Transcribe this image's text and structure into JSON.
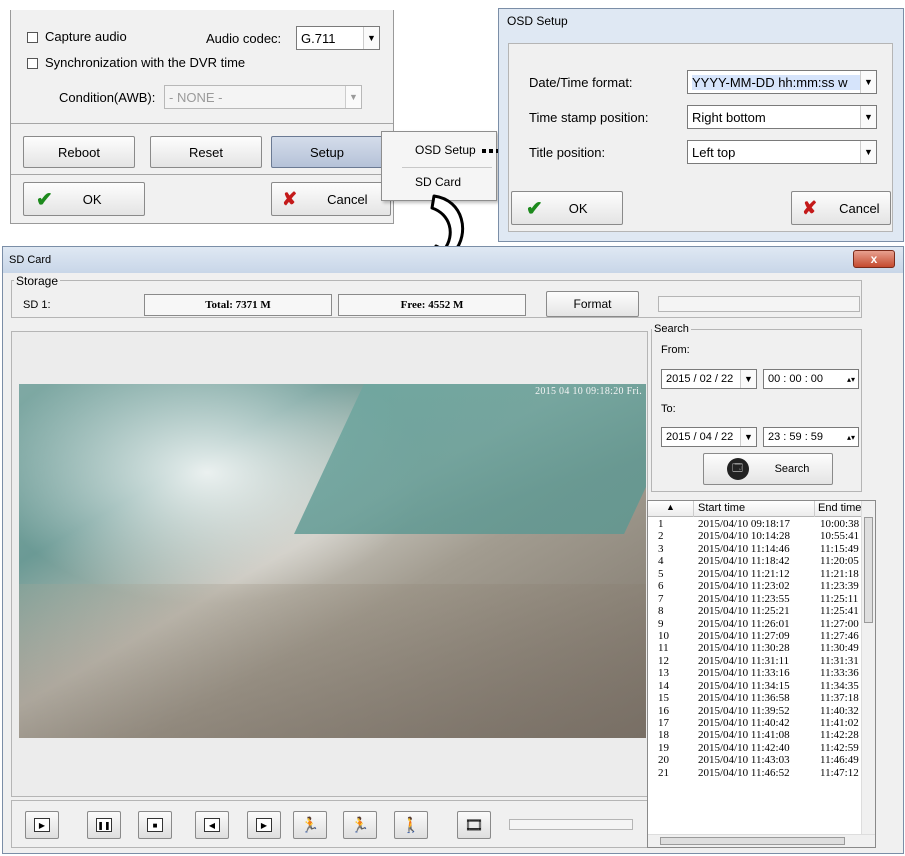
{
  "main": {
    "capture_audio_label": "Capture audio",
    "audio_codec_label": "Audio codec:",
    "audio_codec_value": "G.711",
    "sync_label": "Synchronization with the DVR time",
    "condition_label": "Condition(AWB):",
    "condition_value": "- NONE -",
    "reboot_label": "Reboot",
    "reset_label": "Reset",
    "setup_label": "Setup",
    "ok_label": "OK",
    "cancel_label": "Cancel"
  },
  "popup": {
    "items": [
      "OSD Setup",
      "SD Card"
    ]
  },
  "osd": {
    "title": "OSD Setup",
    "date_format_label": "Date/Time format:",
    "date_format_value": "YYYY-MM-DD hh:mm:ss w",
    "stamp_position_label": "Time stamp position:",
    "stamp_position_value": "Right bottom",
    "title_position_label": "Title position:",
    "title_position_value": "Left top",
    "ok_label": "OK",
    "cancel_label": "Cancel"
  },
  "sd": {
    "title": "SD Card",
    "close_label": "x",
    "storage_label": "Storage",
    "sd1_label": "SD 1:",
    "total": "Total: 7371 M",
    "free": "Free: 4552 M",
    "format_label": "Format",
    "timestamp": "2015 04 10 09:18:20 Fri.",
    "search": {
      "group_label": "Search",
      "from_label": "From:",
      "from_date": "2015 / 02 / 22",
      "from_time": "00 : 00 : 00",
      "to_label": "To:",
      "to_date": "2015 / 04 / 22",
      "to_time": "23 : 59 : 59",
      "button_label": "Search"
    },
    "table": {
      "headers": [
        "Start time",
        "End time"
      ],
      "rows": [
        [
          "1",
          "2015/04/10 09:18:17",
          "10:00:38"
        ],
        [
          "2",
          "2015/04/10 10:14:28",
          "10:55:41"
        ],
        [
          "3",
          "2015/04/10 11:14:46",
          "11:15:49"
        ],
        [
          "4",
          "2015/04/10 11:18:42",
          "11:20:05"
        ],
        [
          "5",
          "2015/04/10 11:21:12",
          "11:21:18"
        ],
        [
          "6",
          "2015/04/10 11:23:02",
          "11:23:39"
        ],
        [
          "7",
          "2015/04/10 11:23:55",
          "11:25:11"
        ],
        [
          "8",
          "2015/04/10 11:25:21",
          "11:25:41"
        ],
        [
          "9",
          "2015/04/10 11:26:01",
          "11:27:00"
        ],
        [
          "10",
          "2015/04/10 11:27:09",
          "11:27:46"
        ],
        [
          "11",
          "2015/04/10 11:30:28",
          "11:30:49"
        ],
        [
          "12",
          "2015/04/10 11:31:11",
          "11:31:31"
        ],
        [
          "13",
          "2015/04/10 11:33:16",
          "11:33:36"
        ],
        [
          "14",
          "2015/04/10 11:34:15",
          "11:34:35"
        ],
        [
          "15",
          "2015/04/10 11:36:58",
          "11:37:18"
        ],
        [
          "16",
          "2015/04/10 11:39:52",
          "11:40:32"
        ],
        [
          "17",
          "2015/04/10 11:40:42",
          "11:41:02"
        ],
        [
          "18",
          "2015/04/10 11:41:08",
          "11:42:28"
        ],
        [
          "19",
          "2015/04/10 11:42:40",
          "11:42:59"
        ],
        [
          "20",
          "2015/04/10 11:43:03",
          "11:46:49"
        ],
        [
          "21",
          "2015/04/10 11:46:52",
          "11:47:12"
        ]
      ]
    }
  }
}
